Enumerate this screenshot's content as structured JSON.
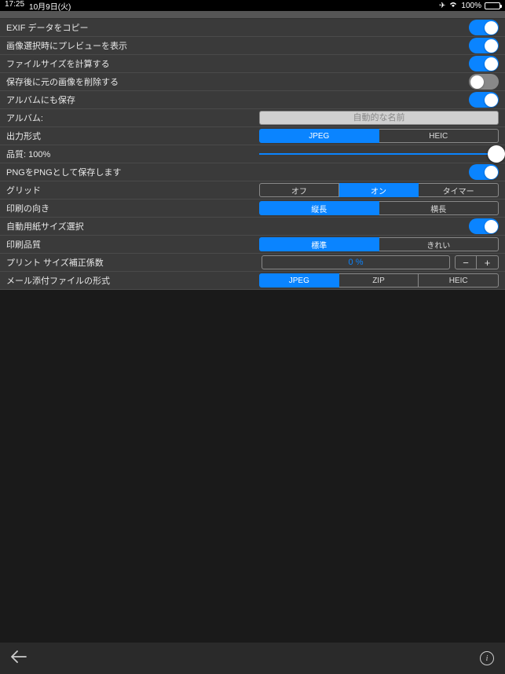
{
  "statusBar": {
    "time": "17:25",
    "date": "10月9日(火)",
    "batteryPct": "100%"
  },
  "rows": {
    "copyExif": "EXIF データをコピー",
    "previewOnSelect": "画像選択時にプレビューを表示",
    "calcFileSize": "ファイルサイズを計算する",
    "deleteAfterSave": "保存後に元の画像を削除する",
    "saveToAlbum": "アルバムにも保存",
    "albumLabel": "アルバム:",
    "albumPlaceholder": "自動的な名前",
    "outputFormat": "出力形式",
    "quality": "品質: 100%",
    "pngAsPng": "PNGをPNGとして保存します",
    "grid": "グリッド",
    "printOrientation": "印刷の向き",
    "autoPaperSize": "自動用紙サイズ選択",
    "printQuality": "印刷品質",
    "printCorrection": "プリント サイズ補正係数",
    "correctionValue": "0 %",
    "mailFormat": "メール添付ファイルの形式"
  },
  "segments": {
    "outputFormat": {
      "opt1": "JPEG",
      "opt2": "HEIC"
    },
    "grid": {
      "opt1": "オフ",
      "opt2": "オン",
      "opt3": "タイマー"
    },
    "orientation": {
      "opt1": "縦長",
      "opt2": "横長"
    },
    "printQuality": {
      "opt1": "標準",
      "opt2": "きれい"
    },
    "mail": {
      "opt1": "JPEG",
      "opt2": "ZIP",
      "opt3": "HEIC"
    }
  },
  "stepper": {
    "minus": "−",
    "plus": "+"
  }
}
